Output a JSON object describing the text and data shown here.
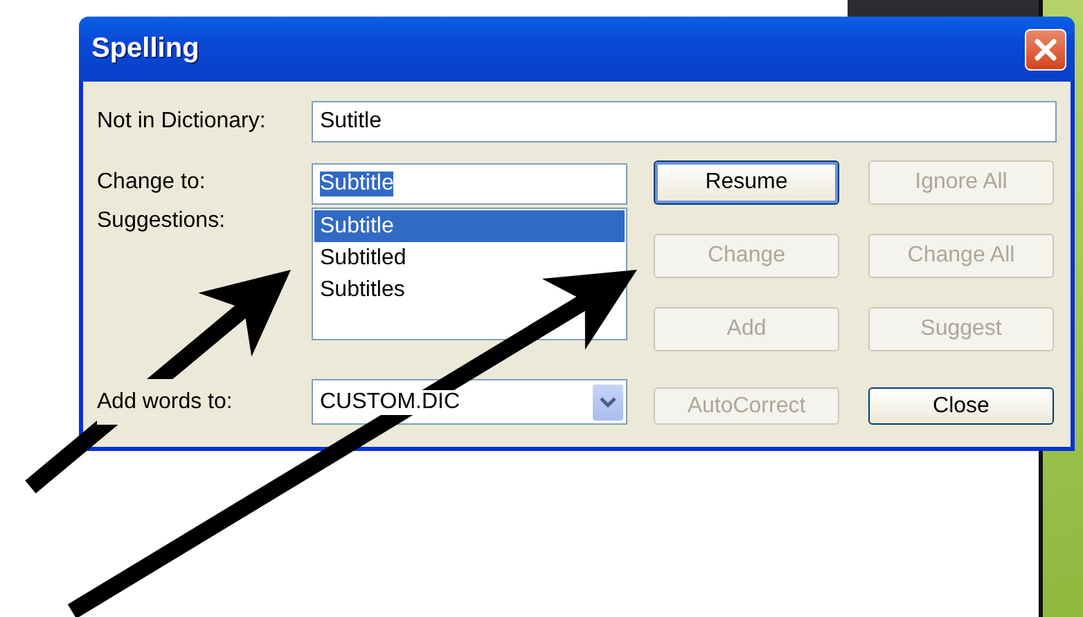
{
  "window": {
    "title": "Spelling"
  },
  "not_in_dictionary": {
    "label": "Not in Dictionary:",
    "value": "Sutitle"
  },
  "change_to": {
    "label": "Change to:",
    "value": "Subtitle",
    "value_selected": true
  },
  "suggestions": {
    "label": "Suggestions:",
    "items": [
      {
        "text": "Subtitle",
        "selected": true
      },
      {
        "text": "Subtitled",
        "selected": false
      },
      {
        "text": "Subtitles",
        "selected": false
      }
    ]
  },
  "add_words_to": {
    "label": "Add words to:",
    "value": "CUSTOM.DIC"
  },
  "buttons": [
    {
      "label": "Resume",
      "disabled": false,
      "focused": true
    },
    {
      "label": "Ignore All",
      "disabled": true,
      "focused": false
    },
    {
      "label": "Change",
      "disabled": true,
      "focused": false
    },
    {
      "label": "Change All",
      "disabled": true,
      "focused": false
    },
    {
      "label": "Add",
      "disabled": true,
      "focused": false
    },
    {
      "label": "Suggest",
      "disabled": true,
      "focused": false
    },
    {
      "label": "AutoCorrect",
      "disabled": true,
      "focused": false
    },
    {
      "label": "Close",
      "disabled": false,
      "focused": false
    }
  ]
}
